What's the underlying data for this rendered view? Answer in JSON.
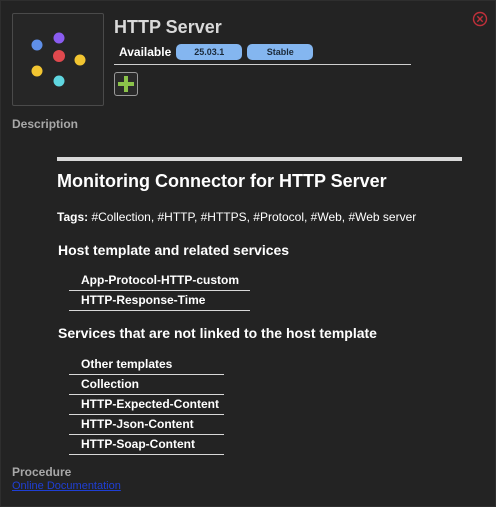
{
  "header": {
    "title": "HTTP Server",
    "status_label": "Available",
    "version_badge": "25.03.1",
    "stability_badge": "Stable"
  },
  "colors": {
    "background": "#232323",
    "badge": "#84b6f0",
    "close": "#c0303a",
    "install": "#8bc34a",
    "link": "#1f3fd6"
  },
  "icons": {
    "close": "close-circle-icon",
    "install": "plus-icon",
    "logo": "connector-dots-logo"
  },
  "description": {
    "heading": "Description",
    "doc_title": "Monitoring Connector for HTTP Server",
    "tags_label": "Tags:",
    "tags_value": " #Collection, #HTTP, #HTTPS, #Protocol, #Web, #Web server",
    "host_section": {
      "heading": "Host template and related services",
      "items": [
        "App-Protocol-HTTP-custom",
        "HTTP-Response-Time"
      ]
    },
    "unlinked_section": {
      "heading": "Services that are not linked to the host template",
      "items": [
        "Other templates",
        "Collection",
        "HTTP-Expected-Content",
        "HTTP-Json-Content",
        "HTTP-Soap-Content"
      ]
    }
  },
  "procedure": {
    "heading": "Procedure",
    "link": "Online Documentation"
  }
}
